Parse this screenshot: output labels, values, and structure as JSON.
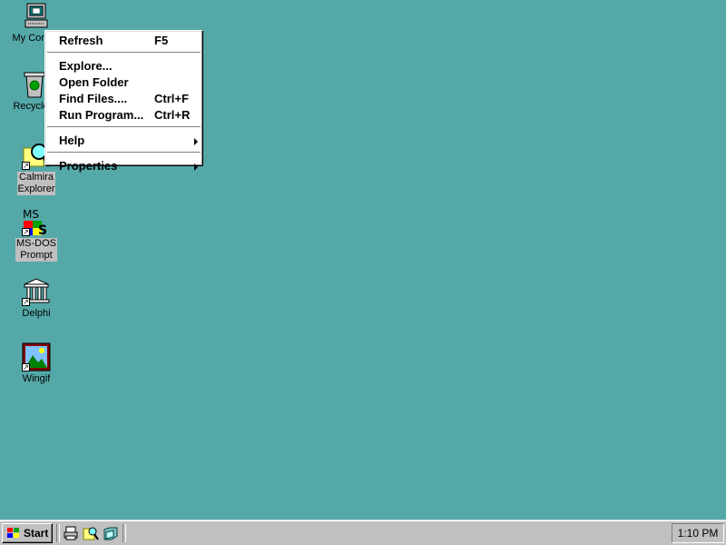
{
  "desktop": {
    "icons": [
      {
        "label": "My Com",
        "name": "my-computer"
      },
      {
        "label": "Recycle",
        "name": "recycle-bin"
      },
      {
        "label": "Calmira\nExplorer",
        "name": "calmira-explorer"
      },
      {
        "label": "MS-DOS\nPrompt",
        "name": "ms-dos-prompt"
      },
      {
        "label": "Delphi",
        "name": "delphi"
      },
      {
        "label": "Wingif",
        "name": "wingif"
      }
    ],
    "background_color": "#55a8a8"
  },
  "context_menu": {
    "items": [
      {
        "label": "Refresh",
        "shortcut": "F5"
      },
      {
        "label": "Explore...",
        "shortcut": ""
      },
      {
        "label": "Open Folder",
        "shortcut": ""
      },
      {
        "label": "Find Files....",
        "shortcut": "Ctrl+F"
      },
      {
        "label": "Run Program...",
        "shortcut": "Ctrl+R"
      },
      {
        "label": "Help",
        "shortcut": ""
      },
      {
        "label": "Properties",
        "shortcut": ""
      }
    ]
  },
  "taskbar": {
    "start_label": "Start",
    "clock": "1:10 PM",
    "quick_launch": [
      "printer-icon",
      "explorer-icon",
      "folder-icon"
    ]
  }
}
